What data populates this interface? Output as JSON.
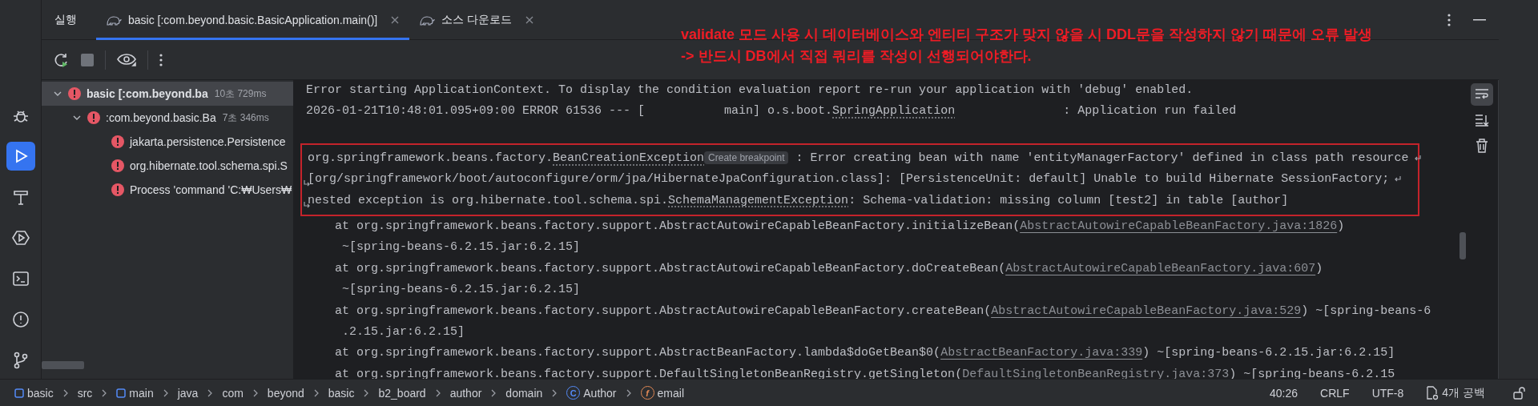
{
  "side_tools": [
    {
      "kind": "debug",
      "selected": false
    },
    {
      "kind": "run",
      "selected": true
    },
    {
      "kind": "build",
      "selected": false
    },
    {
      "kind": "services",
      "selected": false
    },
    {
      "kind": "terminal",
      "selected": false
    },
    {
      "kind": "problems",
      "selected": false
    },
    {
      "kind": "git",
      "selected": false
    }
  ],
  "tool_window": {
    "title": "실행",
    "tabs": [
      {
        "label": "basic [:com.beyond.basic.BasicApplication.main()]",
        "selected": true
      },
      {
        "label": "소스 다운로드",
        "selected": false
      }
    ]
  },
  "annotation": [
    "validate 모드 사용 시 데이터베이스와 엔티티 구조가 맞지 않을 시 DDL문을 작성하지 않기 때문에 오류 발생",
    "-> 반드시 DB에서 직접 쿼리를 작성이 선행되어야한다."
  ],
  "tree": [
    {
      "label": "basic [:com.beyond.ba",
      "time": "10초 729ms",
      "expanded": true,
      "selected": true,
      "children": [
        {
          "label": ":com.beyond.basic.Ba",
          "time": "7초 346ms",
          "expanded": true,
          "selected": false,
          "children": [
            {
              "label": "jakarta.persistence.Persistence",
              "selected": false
            },
            {
              "label": "org.hibernate.tool.schema.spi.S",
              "selected": false
            },
            {
              "label": "Process 'command 'C:₩Users₩",
              "selected": false
            }
          ]
        }
      ]
    }
  ],
  "console": {
    "header_lines": [
      {
        "segments": [
          {
            "kind": "text",
            "text": "Error starting ApplicationContext. To display the condition evaluation report re-run your application with 'debug' enabled."
          }
        ]
      },
      {
        "segments": [
          {
            "kind": "text",
            "text": "2026-01-21T10:48:01.095+09:00 ERROR 61536 --- [           main] o.s.boot."
          },
          {
            "kind": "class",
            "text": "SpringApplication"
          },
          {
            "kind": "text",
            "text": "               : Application run failed"
          }
        ]
      }
    ],
    "error_box": [
      {
        "wrap_end": true,
        "segments": [
          {
            "kind": "text",
            "text": "org.springframework.beans.factory."
          },
          {
            "kind": "class",
            "text": "BeanCreationException"
          },
          {
            "kind": "hint",
            "text": "Create breakpoint"
          },
          {
            "kind": "text",
            "text": " : Error creating bean with name 'entityManagerFactory' defined in class path resource"
          }
        ]
      },
      {
        "wrap_start": true,
        "wrap_end": true,
        "segments": [
          {
            "kind": "text",
            "text": "[org/springframework/boot/autoconfigure/orm/jpa/HibernateJpaConfiguration.class]: [PersistenceUnit: default] Unable to build Hibernate SessionFactory;"
          }
        ]
      },
      {
        "wrap_start": true,
        "segments": [
          {
            "kind": "text",
            "text": "nested exception is org.hibernate.tool.schema.spi."
          },
          {
            "kind": "class",
            "text": "SchemaManagementException"
          },
          {
            "kind": "text",
            "text": ": Schema-validation: missing column [test2] in table [author]"
          }
        ]
      }
    ],
    "trace_lines": [
      {
        "kind": "frame",
        "segments": [
          {
            "kind": "text",
            "text": "at org.springframework.beans.factory.support.AbstractAutowireCapableBeanFactory.initializeBean("
          },
          {
            "kind": "link",
            "text": "AbstractAutowireCapableBeanFactory.java:1826"
          },
          {
            "kind": "text",
            "text": ")"
          }
        ]
      },
      {
        "kind": "continuation",
        "segments": [
          {
            "kind": "text",
            "text": "~[spring-beans-6.2.15.jar:6.2.15]"
          }
        ]
      },
      {
        "kind": "frame",
        "segments": [
          {
            "kind": "text",
            "text": "at org.springframework.beans.factory.support.AbstractAutowireCapableBeanFactory.doCreateBean("
          },
          {
            "kind": "link",
            "text": "AbstractAutowireCapableBeanFactory.java:607"
          },
          {
            "kind": "text",
            "text": ")"
          }
        ]
      },
      {
        "kind": "continuation",
        "segments": [
          {
            "kind": "text",
            "text": "~[spring-beans-6.2.15.jar:6.2.15]"
          }
        ]
      },
      {
        "kind": "frame",
        "segments": [
          {
            "kind": "text",
            "text": "at org.springframework.beans.factory.support.AbstractAutowireCapableBeanFactory.createBean("
          },
          {
            "kind": "link",
            "text": "AbstractAutowireCapableBeanFactory.java:529"
          },
          {
            "kind": "text",
            "text": ") ~[spring-beans-6"
          }
        ]
      },
      {
        "kind": "continuation",
        "segments": [
          {
            "kind": "text",
            "text": ".2.15.jar:6.2.15]"
          }
        ]
      },
      {
        "kind": "frame",
        "segments": [
          {
            "kind": "text",
            "text": "at org.springframework.beans.factory.support.AbstractBeanFactory.lambda$doGetBean$0("
          },
          {
            "kind": "link",
            "text": "AbstractBeanFactory.java:339"
          },
          {
            "kind": "text",
            "text": ") ~[spring-beans-6.2.15.jar:6.2.15]"
          }
        ]
      },
      {
        "kind": "frame",
        "segments": [
          {
            "kind": "text",
            "text": "at org.springframework.beans.factory.support.DefaultSingletonBeanRegistry.getSingleton("
          },
          {
            "kind": "link",
            "text": "DefaultSingletonBeanRegistry.java:373"
          },
          {
            "kind": "text",
            "text": ") ~[spring-beans-6.2.15"
          }
        ]
      }
    ]
  },
  "console_tools": [
    {
      "kind": "soft-wrap",
      "selected": true
    },
    {
      "kind": "scroll-end",
      "selected": false
    },
    {
      "kind": "clear",
      "selected": false
    }
  ],
  "breadcrumbs": [
    {
      "label": "basic",
      "kind": "module"
    },
    {
      "label": "src",
      "kind": "folder"
    },
    {
      "label": "main",
      "kind": "module"
    },
    {
      "label": "java",
      "kind": "folder"
    },
    {
      "label": "com",
      "kind": "folder"
    },
    {
      "label": "beyond",
      "kind": "folder"
    },
    {
      "label": "basic",
      "kind": "folder"
    },
    {
      "label": "b2_board",
      "kind": "folder"
    },
    {
      "label": "author",
      "kind": "folder"
    },
    {
      "label": "domain",
      "kind": "folder"
    },
    {
      "label": "Author",
      "kind": "class",
      "icon": "C"
    },
    {
      "label": "email",
      "kind": "field",
      "icon": "f"
    }
  ],
  "status": {
    "position": "40:26",
    "line_separator": "CRLF",
    "encoding": "UTF-8",
    "indent": "4개 공백"
  }
}
